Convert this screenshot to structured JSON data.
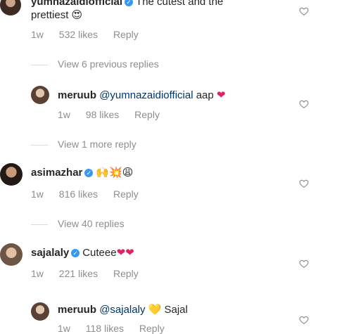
{
  "comments": [
    {
      "username": "yumnazaidiofficial",
      "text_line1": "The cutest and the",
      "text_line2": "prettiest",
      "emoji": "😍",
      "time": "1w",
      "likes": "532 likes",
      "reply": "Reply",
      "view_replies": "View 6 previous replies"
    },
    {
      "username": "meruub",
      "mention": "@yumnazaidiofficial",
      "text": "aap",
      "emoji": "❤",
      "time": "1w",
      "likes": "98 likes",
      "reply": "Reply",
      "view_replies": "View 1 more reply"
    },
    {
      "username": "asimazhar",
      "emoji": "🙌💥😩",
      "time": "1w",
      "likes": "816 likes",
      "reply": "Reply",
      "view_replies": "View 40 replies"
    },
    {
      "username": "sajalaly",
      "text": "Cuteee",
      "emoji": "❤❤",
      "time": "1w",
      "likes": "221 likes",
      "reply": "Reply"
    },
    {
      "username": "meruub",
      "mention": "@sajalaly",
      "emoji": "💛",
      "text": "Sajal",
      "time": "1w",
      "likes": "118 likes",
      "reply": "Reply"
    }
  ],
  "icons": {
    "verified": "verified-badge-icon",
    "like": "heart-outline-icon"
  },
  "colors": {
    "verified": "#3897f0",
    "muted": "#8e8e8e",
    "mention": "#003569"
  }
}
